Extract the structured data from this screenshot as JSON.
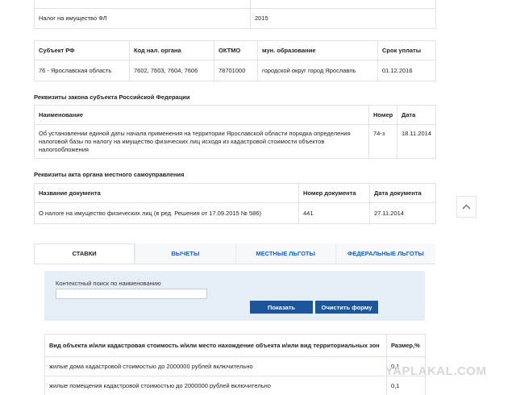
{
  "tax_period": {
    "label": "Налог на имущество ФЛ",
    "year": "2015"
  },
  "subject_table": {
    "headers": [
      "Субъект РФ",
      "Код нал. органа",
      "ОКТМО",
      "мун. образование",
      "Срок уплаты"
    ],
    "row": [
      "76 - Ярославская область",
      "7602, 7603, 7604, 7606",
      "78701000",
      "городской округ город Ярославль",
      "01.12.2016"
    ]
  },
  "law_section": {
    "title": "Реквизиты закона субъекта Российской Федерации",
    "headers": [
      "Наименование",
      "Номер",
      "Дата"
    ],
    "row": [
      "Об установлении единой даты начала применения на территории Ярославской области порядка определения налоговой базы по налогу на имущество физических лиц исходя из кадастровой стоимости объектов налогообложения",
      "74-з",
      "18.11.2014"
    ]
  },
  "act_section": {
    "title": "Реквизиты акта органа местного самоуправления",
    "headers": [
      "Название документа",
      "Номер документа",
      "Дата документа"
    ],
    "row": [
      "О налоге на имущество физических лиц (в ред. Решения от 17.09.2015 № 586)",
      "441",
      "27.11.2014"
    ]
  },
  "tabs": [
    {
      "label": "СТАВКИ",
      "active": true
    },
    {
      "label": "ВЫЧЕТЫ",
      "active": false
    },
    {
      "label": "МЕСТНЫЕ ЛЬГОТЫ",
      "active": false
    },
    {
      "label": "ФЕДЕРАЛЬНЫЕ ЛЬГОТЫ",
      "active": false
    }
  ],
  "search": {
    "label": "Контекстный поиск по наименованию",
    "value": "",
    "show_button": "Показать",
    "clear_button": "Очистить форму"
  },
  "rates_table": {
    "headers": [
      "Вид объекта и/или кадастровая стоимость и/или место нахождение объекта и/или вид территориальных зон",
      "Размер,%"
    ],
    "rows": [
      [
        "жилые дома кадастровой стоимостью до 2000000 рублей включительно",
        "0,1"
      ],
      [
        "жилые помещения кадастровой стоимостью до 2000000 рублей включительно",
        "0,1"
      ]
    ]
  },
  "watermark": "YAPLAKAL.COM",
  "icons": {
    "scroll_top": "chevron-up-icon"
  },
  "colors": {
    "link": "#1f5fa8",
    "button": "#1a5699",
    "panel": "#e6eef8",
    "border": "#dde3ea"
  }
}
